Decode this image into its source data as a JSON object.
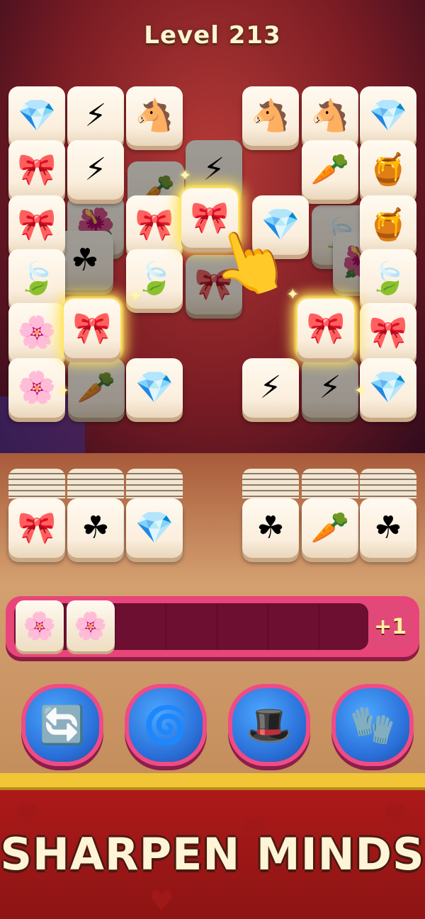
{
  "header": {
    "level_label": "Level 213"
  },
  "board": {
    "tiles_top_left": [
      "gem-purple",
      "lightning-yellow",
      "horse-cookie",
      "bow-red",
      "lightning-yellow",
      "bow-red",
      "leaf-blue",
      "flower-pink",
      "flower-pink"
    ],
    "tiles_top_right": [
      "horse-cookie",
      "horse-cookie",
      "gem-purple",
      "carrot-orange",
      "jar-pink",
      "jar-pink",
      "leaf-blue",
      "bow-red",
      "gem-purple"
    ],
    "selected_tile": "bow-red",
    "highlighted_tiles": [
      "bow-red",
      "bow-red",
      "bow-red"
    ]
  },
  "stacks": [
    "bow-red",
    "clover-green",
    "gem-purple",
    "clover-green",
    "carrot-orange",
    "clover-green"
  ],
  "tray": {
    "items": [
      "flower-pink",
      "flower-pink"
    ],
    "slots": 7,
    "extra_slot_label": "+1"
  },
  "powerups": [
    {
      "name": "undo",
      "icon": "undo-icon"
    },
    {
      "name": "shuffle",
      "icon": "pinwheel-icon"
    },
    {
      "name": "magic-hat",
      "icon": "top-hat-icon"
    },
    {
      "name": "grab",
      "icon": "glove-icon"
    }
  ],
  "banner": {
    "slogan": "SHARPEN MINDS"
  },
  "colors": {
    "tray": "#e8467a",
    "powerup_ring": "#f04b86",
    "banner": "#b11a1a",
    "stripe": "#f2c537"
  }
}
